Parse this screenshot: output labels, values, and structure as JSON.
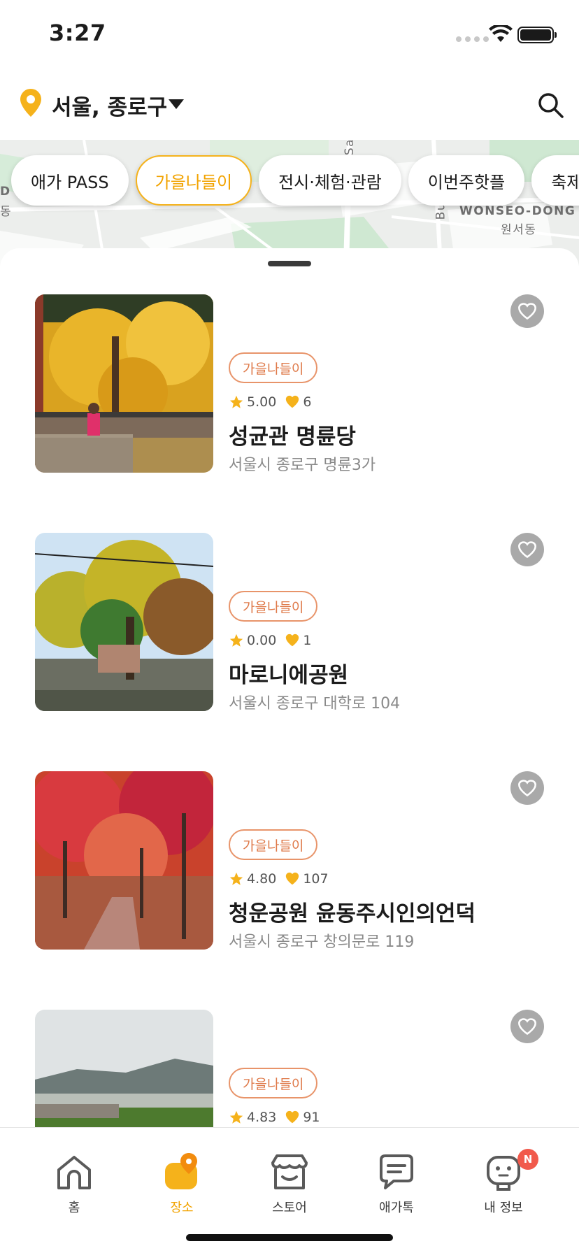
{
  "status_bar": {
    "time": "3:27"
  },
  "header": {
    "location": "서울, 종로구",
    "icons": {
      "pin": "location-pin-icon",
      "search": "search-icon"
    }
  },
  "map": {
    "labels": {
      "wonseo_en": "WONSEO-DONG",
      "wonseo_ko": "원서동",
      "left": "D",
      "left2": "동",
      "bukchon": "Buk",
      "sa": "Sa"
    }
  },
  "chips": [
    "애가 PASS",
    "가을나들이",
    "전시·체험·관람",
    "이번주핫플",
    "축제&"
  ],
  "active_chip": "가을나들이",
  "places": [
    {
      "tag": "가을나들이",
      "rating": "5.00",
      "likes": "6",
      "name": "성균관 명륜당",
      "address": "서울시 종로구 명륜3가"
    },
    {
      "tag": "가을나들이",
      "rating": "0.00",
      "likes": "1",
      "name": "마로니에공원",
      "address": "서울시 종로구 대학로 104"
    },
    {
      "tag": "가을나들이",
      "rating": "4.80",
      "likes": "107",
      "name": "청운공원 윤동주시인의언덕",
      "address": "서울시 종로구 창의문로 119"
    },
    {
      "tag": "가을나들이",
      "rating": "4.83",
      "likes": "91",
      "name": "",
      "address": ""
    }
  ],
  "tabs": [
    {
      "label": "홈",
      "icon": "home-icon"
    },
    {
      "label": "장소",
      "icon": "place-icon"
    },
    {
      "label": "스토어",
      "icon": "store-icon"
    },
    {
      "label": "애가톡",
      "icon": "chat-icon"
    },
    {
      "label": "내 정보",
      "icon": "profile-icon",
      "badge": "N"
    }
  ],
  "active_tab": "장소",
  "colors": {
    "accent": "#f5b21b",
    "tag": "#df7a4a",
    "badge": "#f15a4c",
    "heart": "#f5b21b"
  }
}
